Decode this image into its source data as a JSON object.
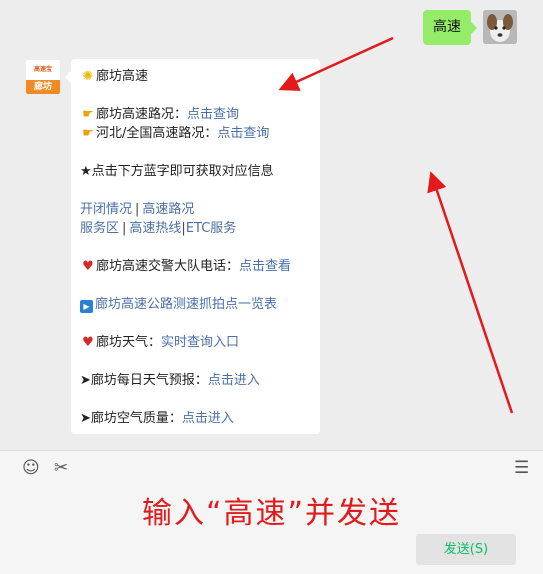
{
  "outgoing": {
    "text": "高速"
  },
  "account": {
    "avatar_top": "高速宝",
    "avatar_bottom": "廊坊"
  },
  "message": {
    "title": "廊坊高速",
    "road_label": "廊坊高速路况：",
    "road_link": "点击查询",
    "hebei_label": "河北/全国高速路况：",
    "hebei_link": "点击查询",
    "hint": "★点击下方蓝字即可获取对应信息",
    "link_open": "开闭情况",
    "link_roads": "高速路况",
    "link_service": "服务区",
    "link_hotline": "高速热线",
    "link_etc": "ETC服务",
    "police_label": "廊坊高速交警大队电话：",
    "police_link": "点击查看",
    "camera_link": "廊坊高速公路测速抓拍点一览表",
    "weather_label": "廊坊天气：",
    "weather_link": "实时查询入口",
    "forecast_label": "➤廊坊每日天气预报：",
    "forecast_link": "点击进入",
    "air_label": "➤廊坊空气质量：",
    "air_link": "点击进入"
  },
  "toolbar": {
    "emoji_icon": "☺",
    "scissors_icon": "✂",
    "chat_icon": "☰"
  },
  "instruction": "输入“高速”并发送",
  "send_label": "发送(S)",
  "colors": {
    "bubble_out": "#95ec69",
    "link": "#4a70a8",
    "instruction": "#e4191b",
    "send_text": "#07c160"
  }
}
